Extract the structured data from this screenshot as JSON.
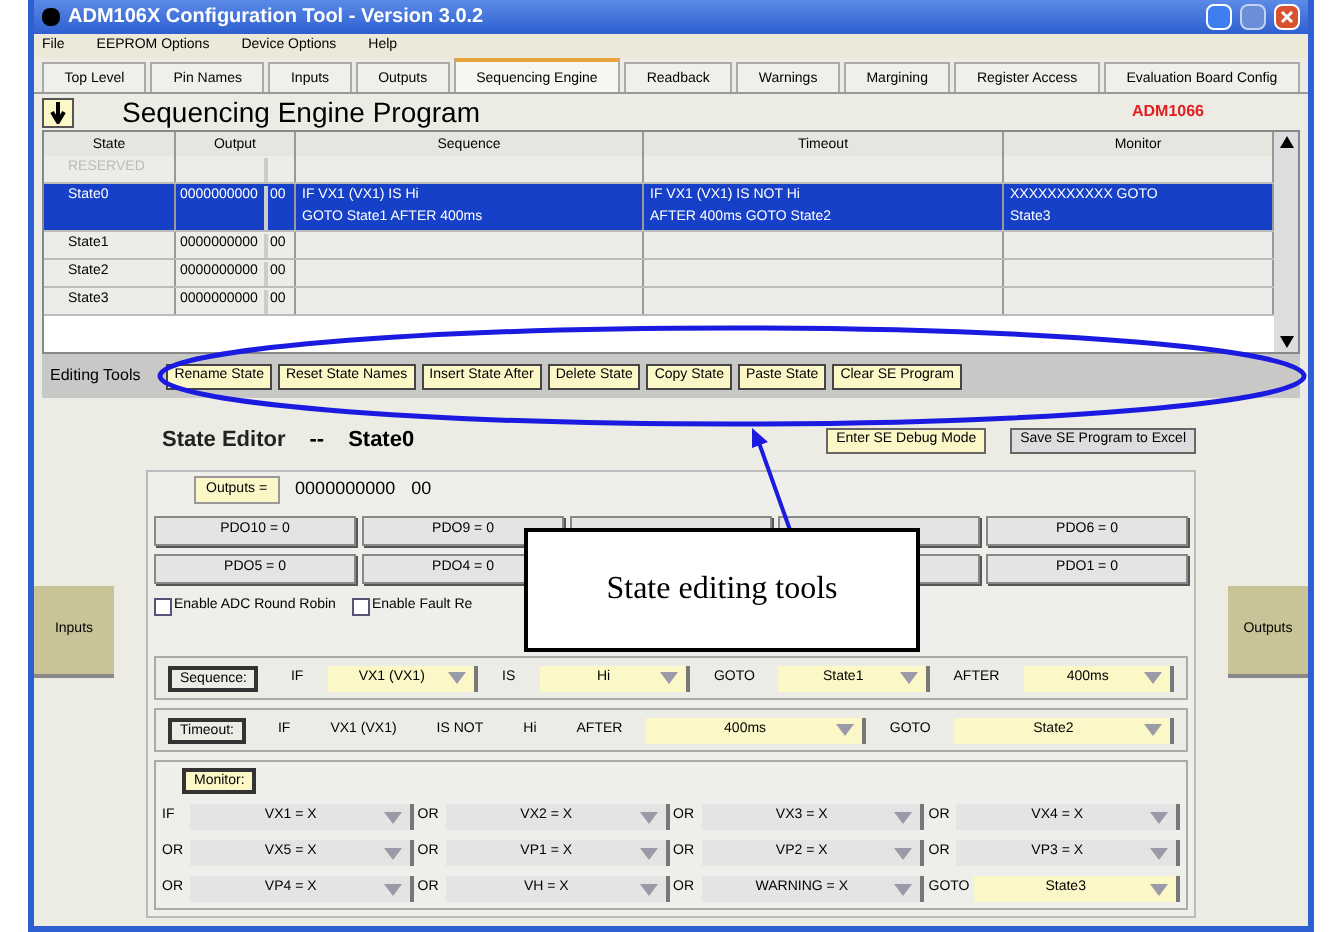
{
  "window": {
    "title": "ADM106X Configuration Tool - Version 3.0.2"
  },
  "menu": [
    "File",
    "EEPROM Options",
    "Device Options",
    "Help"
  ],
  "tabs": [
    {
      "label": "Top Level",
      "selected": false
    },
    {
      "label": "Pin Names",
      "selected": false
    },
    {
      "label": "Inputs",
      "selected": false
    },
    {
      "label": "Outputs",
      "selected": false
    },
    {
      "label": "Sequencing Engine",
      "selected": true
    },
    {
      "label": "Readback",
      "selected": false
    },
    {
      "label": "Warnings",
      "selected": false
    },
    {
      "label": "Margining",
      "selected": false
    },
    {
      "label": "Register Access",
      "selected": false
    },
    {
      "label": "Evaluation Board Config",
      "selected": false
    }
  ],
  "heading": {
    "title": "Sequencing Engine Program",
    "device": "ADM1066"
  },
  "table": {
    "columns": [
      "State",
      "Output",
      "Sequence",
      "Timeout",
      "Monitor"
    ],
    "rows": [
      {
        "state": "RESERVED",
        "selected": false,
        "disabled": true
      },
      {
        "state": "State0",
        "output": "0000000000",
        "output_2": "00",
        "sequence": [
          "IF VX1 (VX1) IS Hi",
          "GOTO State1 AFTER 400ms"
        ],
        "timeout": [
          "IF VX1 (VX1) IS NOT Hi",
          "AFTER 400ms GOTO State2"
        ],
        "monitor": [
          "XXXXXXXXXXX GOTO",
          "State3"
        ],
        "selected": true,
        "disabled": false
      },
      {
        "state": "State1",
        "output": "0000000000",
        "output_2": "00",
        "selected": false,
        "disabled": false
      },
      {
        "state": "State2",
        "output": "0000000000",
        "output_2": "00",
        "selected": false,
        "disabled": false
      },
      {
        "state": "State3",
        "output": "0000000000",
        "output_2": "00",
        "selected": false,
        "disabled": false
      }
    ]
  },
  "editing_tools": {
    "label": "Editing Tools",
    "buttons": [
      "Rename State",
      "Reset State Names",
      "Insert State After",
      "Delete State",
      "Copy State",
      "Paste State",
      "Clear SE Program"
    ]
  },
  "state_editor": {
    "title": "State Editor",
    "separator": "--",
    "state": "State0",
    "buttons": [
      "Enter SE Debug Mode",
      "Save SE Program to Excel"
    ],
    "outputs_label": "Outputs =",
    "outputs_value": "0000000000",
    "outputs_value_2": "00",
    "pdo_rows": [
      [
        "PDO10 = 0",
        "PDO9 = 0",
        null,
        null,
        "PDO6 = 0"
      ],
      [
        "PDO5 = 0",
        "PDO4 = 0",
        null,
        null,
        "PDO1 = 0"
      ]
    ],
    "checkboxes": [
      {
        "label": "Enable ADC Round Robin",
        "checked": false
      },
      {
        "label": "Enable Fault Re",
        "checked": false
      }
    ],
    "inputs_button": "Inputs",
    "outputs_button": "Outputs",
    "sequence": {
      "label": "Sequence:",
      "items": [
        {
          "kind": "text",
          "text": "IF"
        },
        {
          "kind": "dropdown",
          "text": "VX1 (VX1)",
          "highlighted": true
        },
        {
          "kind": "text",
          "text": "IS"
        },
        {
          "kind": "dropdown",
          "text": "Hi",
          "highlighted": true
        },
        {
          "kind": "text",
          "text": "GOTO"
        },
        {
          "kind": "dropdown",
          "text": "State1",
          "highlighted": true
        },
        {
          "kind": "text",
          "text": "AFTER"
        },
        {
          "kind": "dropdown",
          "text": "400ms",
          "highlighted": true
        }
      ]
    },
    "timeout": {
      "label": "Timeout:",
      "items": [
        {
          "kind": "text",
          "text": "IF"
        },
        {
          "kind": "text",
          "text": "VX1 (VX1)"
        },
        {
          "kind": "text",
          "text": "IS NOT"
        },
        {
          "kind": "text",
          "text": "Hi"
        },
        {
          "kind": "text",
          "text": "AFTER"
        },
        {
          "kind": "dropdown",
          "text": "400ms",
          "highlighted": true
        },
        {
          "kind": "text",
          "text": "GOTO"
        },
        {
          "kind": "dropdown",
          "text": "State2",
          "highlighted": true
        }
      ]
    },
    "monitor": {
      "label": "Monitor:",
      "rows": [
        [
          {
            "op": "IF",
            "value": "VX1 = X",
            "highlighted": false
          },
          {
            "op": "OR",
            "value": "VX2 = X",
            "highlighted": false
          },
          {
            "op": "OR",
            "value": "VX3 = X",
            "highlighted": false
          },
          {
            "op": "OR",
            "value": "VX4 = X",
            "highlighted": false
          }
        ],
        [
          {
            "op": "OR",
            "value": "VX5 = X",
            "highlighted": false
          },
          {
            "op": "OR",
            "value": "VP1 = X",
            "highlighted": false
          },
          {
            "op": "OR",
            "value": "VP2 = X",
            "highlighted": false
          },
          {
            "op": "OR",
            "value": "VP3 = X",
            "highlighted": false
          }
        ],
        [
          {
            "op": "OR",
            "value": "VP4 = X",
            "highlighted": false
          },
          {
            "op": "OR",
            "value": "VH = X",
            "highlighted": false
          },
          {
            "op": "OR",
            "value": "WARNING = X",
            "highlighted": false
          },
          {
            "op": "GOTO",
            "value": "State3",
            "highlighted": true
          }
        ]
      ]
    }
  },
  "callout": {
    "text": "State editing tools"
  }
}
